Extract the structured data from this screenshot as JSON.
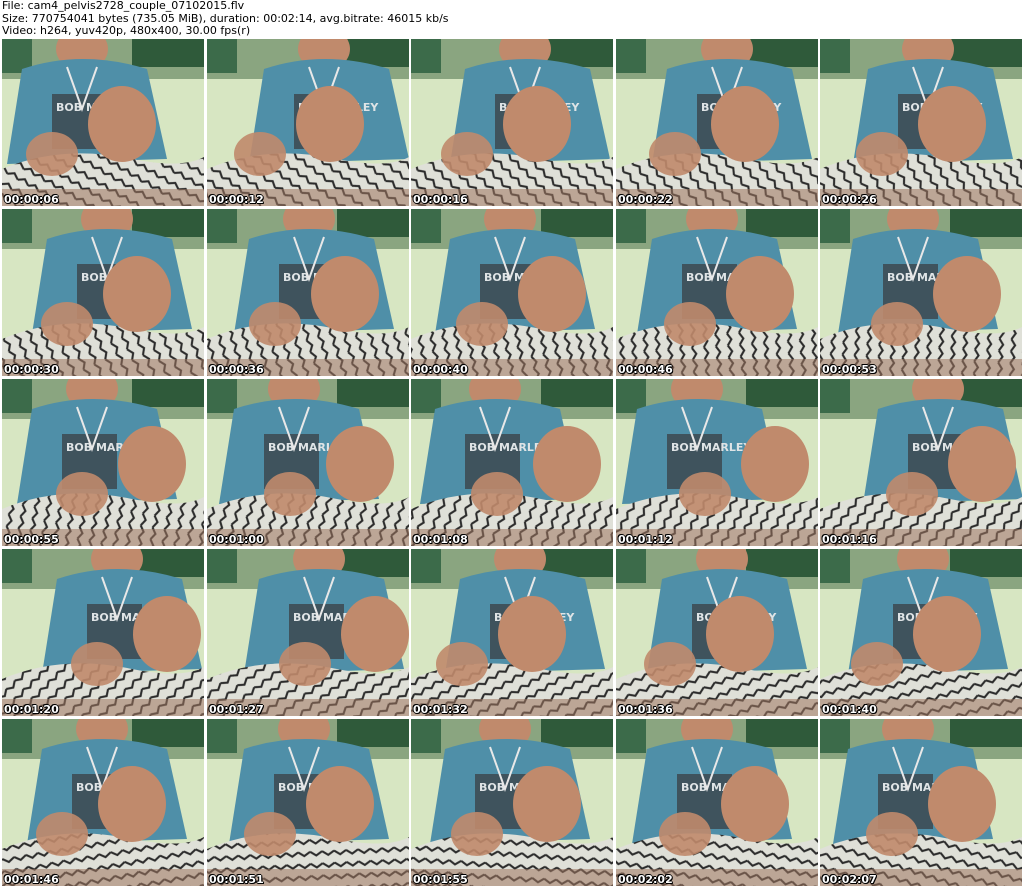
{
  "header": {
    "line1": "File: cam4_pelvis2728_couple_07102015.flv",
    "line2": "Size: 770754041 bytes (735.05 MiB), duration: 00:02:14, avg.bitrate: 46015 kb/s",
    "line3": "Video: h264, yuv420p, 480x400, 30.00 fps(r)"
  },
  "thumbnails": [
    {
      "timestamp": "00:00:06"
    },
    {
      "timestamp": "00:00:12"
    },
    {
      "timestamp": "00:00:16"
    },
    {
      "timestamp": "00:00:22"
    },
    {
      "timestamp": "00:00:26"
    },
    {
      "timestamp": "00:00:30"
    },
    {
      "timestamp": "00:00:36"
    },
    {
      "timestamp": "00:00:40"
    },
    {
      "timestamp": "00:00:46"
    },
    {
      "timestamp": "00:00:53"
    },
    {
      "timestamp": "00:00:55"
    },
    {
      "timestamp": "00:01:00"
    },
    {
      "timestamp": "00:01:08"
    },
    {
      "timestamp": "00:01:12"
    },
    {
      "timestamp": "00:01:16"
    },
    {
      "timestamp": "00:01:20"
    },
    {
      "timestamp": "00:01:27"
    },
    {
      "timestamp": "00:01:32"
    },
    {
      "timestamp": "00:01:36"
    },
    {
      "timestamp": "00:01:40"
    },
    {
      "timestamp": "00:01:46"
    },
    {
      "timestamp": "00:01:51"
    },
    {
      "timestamp": "00:01:55"
    },
    {
      "timestamp": "00:02:02"
    },
    {
      "timestamp": "00:02:07"
    }
  ],
  "colors": {
    "wall": "#8aa580",
    "couch": "#d7e6c2",
    "shirt": "#4f8fa8",
    "skin": "#c08a6c",
    "shorts": "#dfe0d8"
  }
}
